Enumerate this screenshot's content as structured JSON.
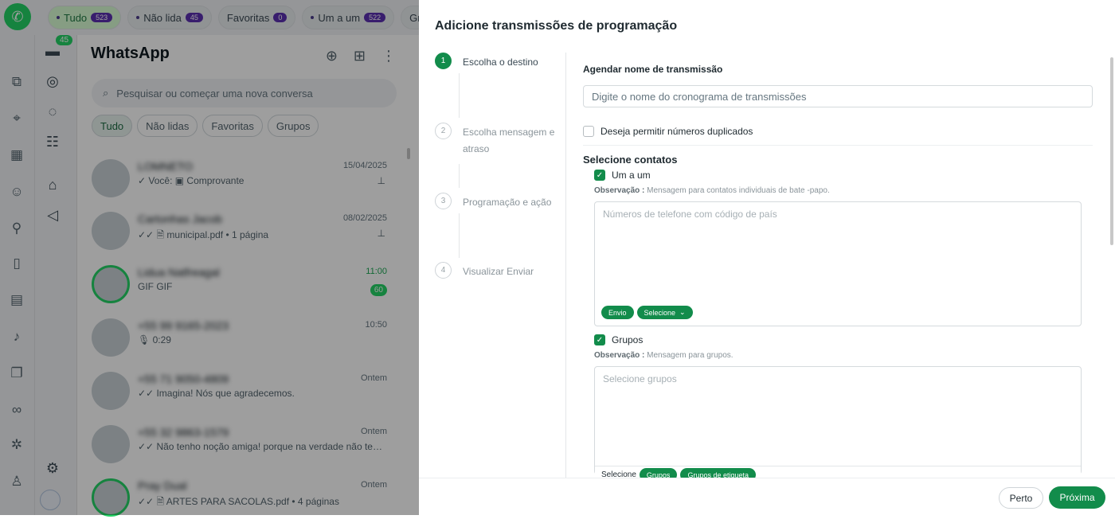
{
  "topbar": {
    "tabs": [
      {
        "label": "Tudo",
        "count": "523"
      },
      {
        "label": "Não lida",
        "count": "45"
      },
      {
        "label": "Favoritas",
        "count": "0"
      },
      {
        "label": "Um a um",
        "count": "522"
      },
      {
        "label": "Gr",
        "count": ""
      }
    ]
  },
  "nav": {
    "unread_badge": "45"
  },
  "chatlist": {
    "title": "WhatsApp",
    "search_placeholder": "Pesquisar ou começar uma nova conversa",
    "chips": [
      "Tudo",
      "Não lidas",
      "Favoritas",
      "Grupos"
    ],
    "chats": [
      {
        "name": "LOMNETO",
        "msg": "✓ Você: ▣ Comprovante",
        "time": "15/04/2025",
        "count": "",
        "pinned": true
      },
      {
        "name": "Cartonhas Jacob",
        "msg": "✓✓ 🗎 municipal.pdf • 1 página",
        "time": "08/02/2025",
        "count": "",
        "pinned": true
      },
      {
        "name": "Lidua Natfreagal",
        "msg": "GIF GIF",
        "time": "11:00",
        "count": "60",
        "pinned": false
      },
      {
        "name": "+55 99 9165-2023",
        "msg": "🎙 0:29",
        "time": "10:50",
        "count": "",
        "pinned": false
      },
      {
        "name": "+55 71 9050-4809",
        "msg": "✓✓ Imagina! Nós que agradecemos.",
        "time": "Ontem",
        "count": "",
        "pinned": false
      },
      {
        "name": "+55 32 9863-1579",
        "msg": "✓✓ Não tenho noção amiga! porque na verdade não te…",
        "time": "Ontem",
        "count": "",
        "pinned": false
      },
      {
        "name": "Pray Dual",
        "msg": "✓✓ 🗎 ARTES PARA SACOLAS.pdf • 4 páginas",
        "time": "Ontem",
        "count": "",
        "pinned": false
      }
    ]
  },
  "modal": {
    "title": "Adicione transmissões de programação",
    "steps": [
      {
        "num": "1",
        "label": "Escolha o destino"
      },
      {
        "num": "2",
        "label": "Escolha mensagem e atraso"
      },
      {
        "num": "3",
        "label": "Programação e ação"
      },
      {
        "num": "4",
        "label": "Visualizar Enviar"
      }
    ],
    "name_label": "Agendar nome de transmissão",
    "name_placeholder": "Digite o nome do cronograma de transmissões",
    "duplicates_label": "Deseja permitir números duplicados",
    "contacts_label": "Selecione contatos",
    "one_to_one": {
      "label": "Um a um",
      "obs_prefix": "Observação :",
      "obs_text": "Mensagem para contatos individuais de bate -papo.",
      "placeholder": "Números de telefone com código de país",
      "btn_send": "Envio",
      "btn_select": "Selecione"
    },
    "groups": {
      "label": "Grupos",
      "obs_prefix": "Observação :",
      "obs_text": "Mensagem para grupos.",
      "placeholder": "Selecione grupos",
      "footer_label": "Selecione",
      "btn_groups": "Grupos",
      "btn_label_groups": "Grupos de etiqueta"
    },
    "btn_close": "Perto",
    "btn_next": "Próxima"
  },
  "colors": {
    "accent": "#128c4b",
    "whatsapp": "#25d366",
    "badge": "#5b2fb0"
  }
}
